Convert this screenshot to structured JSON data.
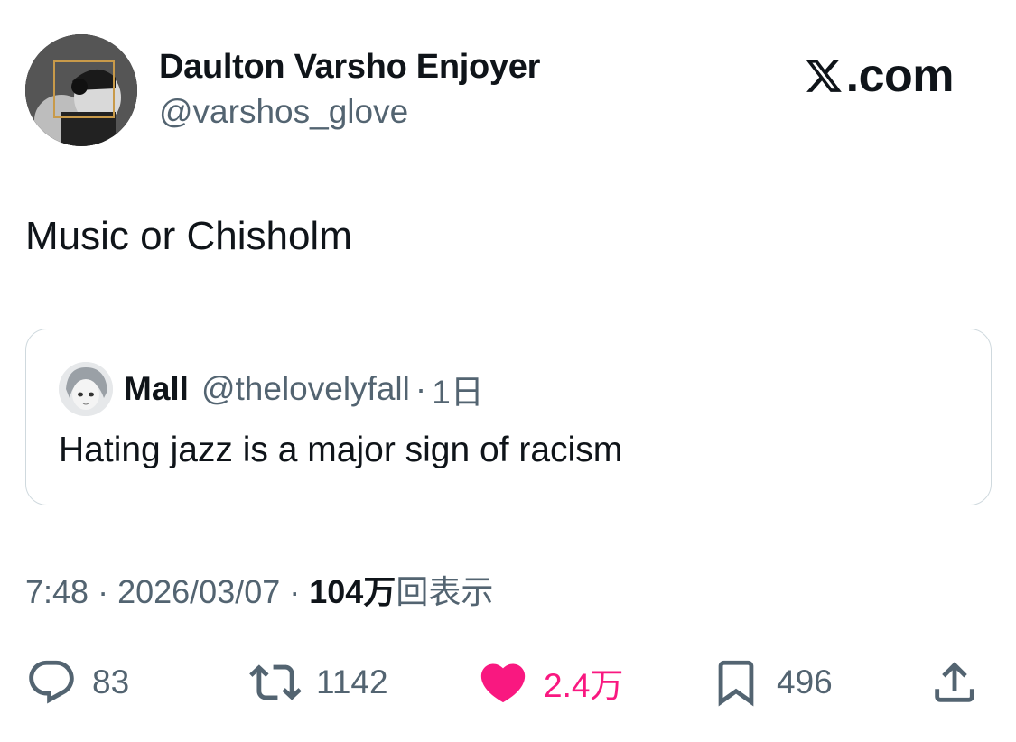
{
  "author": {
    "display_name": "Daulton Varsho Enjoyer",
    "handle": "@varshos_glove"
  },
  "brand": {
    "label": ".com",
    "icon": "x-logo-icon"
  },
  "tweet": {
    "text": "Music or Chisholm"
  },
  "quoted_tweet": {
    "display_name": "Mall",
    "handle": "@thelovelyfall",
    "separator": "·",
    "time": "1日",
    "text": "Hating jazz is a major sign of racism"
  },
  "meta": {
    "time": "7:48",
    "sep1": " · ",
    "date": "2026/03/07",
    "sep2": " · ",
    "views_count": "104万",
    "views_label": "回表示"
  },
  "actions": {
    "reply": {
      "icon": "reply-icon",
      "count": "83"
    },
    "retweet": {
      "icon": "retweet-icon",
      "count": "1142"
    },
    "like": {
      "icon": "heart-icon",
      "count": "2.4万",
      "color": "#f91880"
    },
    "bookmark": {
      "icon": "bookmark-icon",
      "count": "496"
    },
    "share": {
      "icon": "share-icon"
    }
  },
  "colors": {
    "text_primary": "#0f1419",
    "text_secondary": "#536471",
    "border": "#cfd9de",
    "like_active": "#f91880"
  }
}
